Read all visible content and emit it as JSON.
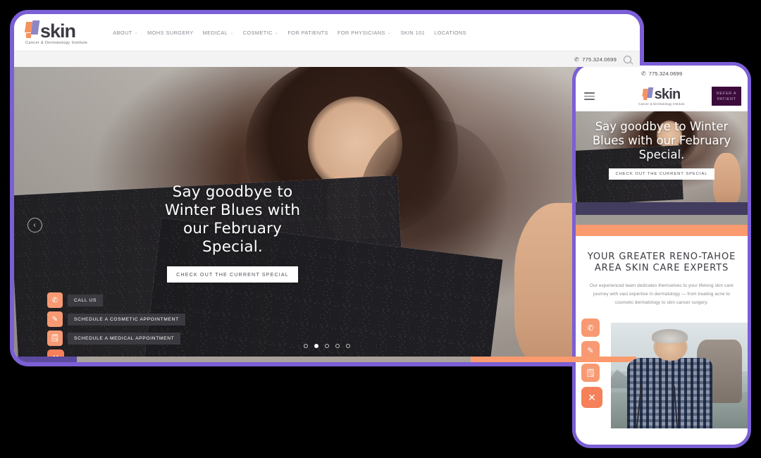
{
  "brand": {
    "word": "skin",
    "tagline": "Cancer & Dermatology Institute",
    "accent_orange": "#f79a74",
    "accent_purple": "#7b5fd4",
    "band_purple": "#423c5e",
    "band_gray": "#a09a95",
    "band_orange": "#fa9a6e",
    "refer_bg": "#3c0b3c"
  },
  "desktop": {
    "nav": [
      {
        "label": "ABOUT",
        "caret": "⌄"
      },
      {
        "label": "MOHS SURGERY",
        "caret": ""
      },
      {
        "label": "MEDICAL",
        "caret": "⌄"
      },
      {
        "label": "COSMETIC",
        "caret": "⌄"
      },
      {
        "label": "FOR PATIENTS",
        "caret": ""
      },
      {
        "label": "FOR PHYSICIANS",
        "caret": "⌄"
      },
      {
        "label": "SKIN 101",
        "caret": ""
      },
      {
        "label": "LOCATIONS",
        "caret": ""
      }
    ],
    "phone": "775.324.0699",
    "phone_glyph": "✆",
    "hero": {
      "title": "Say goodbye to Winter Blues with our February Special.",
      "cta": "CHECK OUT THE CURRENT SPECIAL",
      "prev_arrow": "‹",
      "dots_total": 5,
      "dot_active_index": 1
    },
    "fab": [
      {
        "icon": "✆",
        "icon_name": "phone-icon",
        "label": "CALL US"
      },
      {
        "icon": "✎",
        "icon_name": "pen-icon",
        "label": "SCHEDULE A COSMETIC APPOINTMENT"
      },
      {
        "icon": "🗒",
        "icon_name": "calendar-icon",
        "label": "SCHEDULE A MEDICAL APPOINTMENT"
      }
    ],
    "fab_close": "✕"
  },
  "mobile": {
    "phone": "775.324.0699",
    "phone_glyph": "✆",
    "refer_line1": "REFER A",
    "refer_line2": "PATIENT",
    "hero": {
      "title": "Say goodbye to Winter Blues with our February Special.",
      "cta": "CHECK OUT THE CURRENT SPECIAL"
    },
    "section": {
      "heading": "YOUR GREATER RENO-TAHOE AREA SKIN CARE EXPERTS",
      "body": "Our experienced team dedicates themselves to your lifelong skin care journey with vast expertise in dermatology — from treating acne to cosmetic dermatology to skin cancer surgery."
    },
    "fab": [
      {
        "icon": "✆",
        "icon_name": "phone-icon"
      },
      {
        "icon": "✎",
        "icon_name": "pen-icon"
      },
      {
        "icon": "🗒",
        "icon_name": "calendar-icon"
      }
    ],
    "fab_close": "✕"
  }
}
